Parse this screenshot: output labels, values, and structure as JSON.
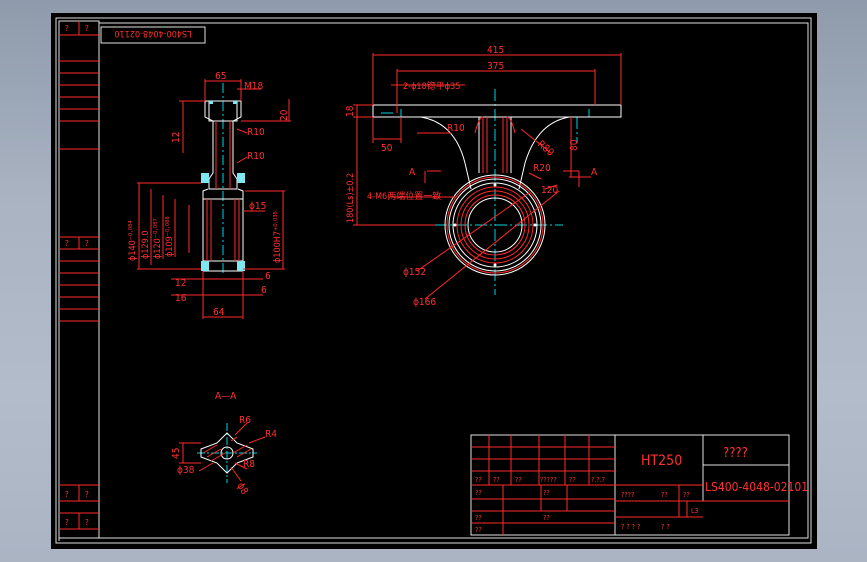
{
  "drawing": {
    "number_tab": "LS400-4048-02110",
    "title_box_marks": [
      "?",
      "?"
    ],
    "side_marks": {
      "r1": [
        "?",
        "?"
      ],
      "r2": [
        "?",
        "?"
      ],
      "r3": [
        "?",
        "?"
      ]
    },
    "section_label": "A—A",
    "view_letter_left": "A",
    "view_letter_right": "A",
    "side_view_dims": {
      "d65": "65",
      "m18": "M18",
      "d12": "12",
      "d20": "20",
      "r10a": "R10",
      "r10b": "R10",
      "phi15": "ϕ15",
      "phi140": "ϕ140⁻⁰·⁰⁸⁴",
      "phi129": "ϕ129.0",
      "phi120": "ϕ120⁻⁰·⁰⁸⁷",
      "phi109": "ϕ109⁻⁰·⁰⁸⁸",
      "phi100": "ϕ100H7⁺⁰·⁰³⁵",
      "d12b": "12",
      "d16": "16",
      "d64": "64",
      "d6a": "6",
      "d6b": "6"
    },
    "front_view_dims": {
      "d415": "415",
      "d375": "375",
      "holes": "2-ϕ18锪平ϕ35",
      "d18": "18",
      "d50": "50",
      "r10": "R10",
      "r80": "R80",
      "d80": "80",
      "r20": "R20",
      "d120": "120",
      "height": "180(Ls)±0.2",
      "m6": "4-M6两端位置一致",
      "phi152": "ϕ152",
      "phi166": "ϕ166"
    },
    "section_dims": {
      "r6": "R6",
      "r4": "R4",
      "d45": "45",
      "r8": "R8",
      "phi38": "ϕ38",
      "phi8": "ϕ8"
    }
  },
  "title_block": {
    "material": "HT250",
    "name": "????",
    "drawing_no": "LS400-4048-02101",
    "row_labels": [
      "??",
      "??",
      "??",
      "?????",
      "??",
      "?.?.?"
    ],
    "left_labels": [
      "??",
      "??",
      "??",
      "??",
      "??"
    ],
    "mid_label": "??",
    "stage_label": "????",
    "stage_cells": [
      "??",
      "??"
    ],
    "scale_label": "?",
    "sheet_label": "? ?  ? ?",
    "sheet_total": "?  ?",
    "l3": "L3"
  },
  "colors": {
    "frame": "#e1e1e1",
    "red": "#ff2a2a",
    "cyan": "#00d5e0",
    "white": "#ffffff",
    "bg": "#000000"
  }
}
